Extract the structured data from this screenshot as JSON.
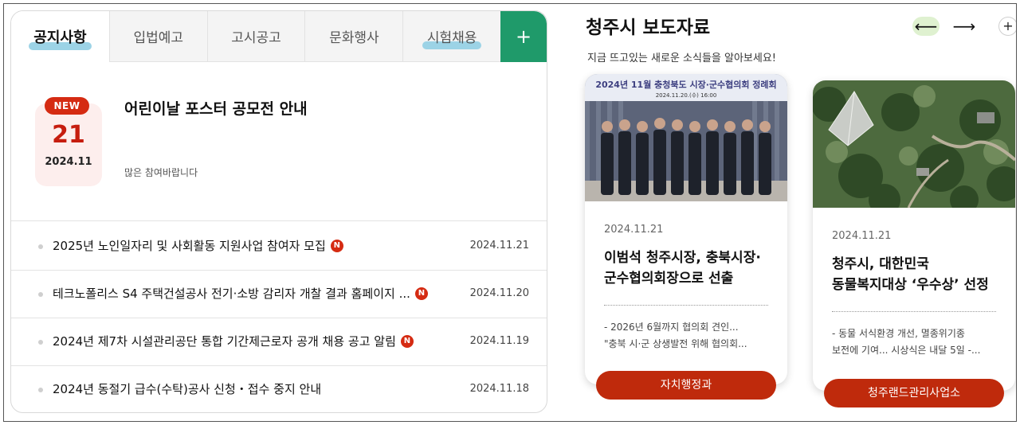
{
  "tabs": [
    {
      "label": "공지사항"
    },
    {
      "label": "입법예고"
    },
    {
      "label": "고시공고"
    },
    {
      "label": "문화행사"
    },
    {
      "label": "시험채용"
    },
    {
      "label": "+"
    }
  ],
  "featured": {
    "badge": "NEW",
    "day": "21",
    "year_month": "2024.11",
    "title": "어린이날 포스터 공모전 안내",
    "desc": "많은 참여바랍니다"
  },
  "notices": [
    {
      "title": "2025년 노인일자리 및 사회활동 지원사업 참여자 모집",
      "badge": "N",
      "date": "2024.11.21"
    },
    {
      "title": "테크노폴리스 S4 주택건설공사 전기·소방 감리자 개찰 결과 홈페이지 ...",
      "badge": "N",
      "date": "2024.11.20"
    },
    {
      "title": "2024년 제7차 시설관리공단 통합 기간제근로자 공개 채용 공고 알림",
      "badge": "N",
      "date": "2024.11.19"
    },
    {
      "title": "2024년 동절기 급수(수탁)공사 신청・접수 중지 안내",
      "date": "2024.11.18"
    }
  ],
  "press": {
    "title": "청주시 보도자료",
    "subtitle": "지금 뜨고있는 새로운 소식들을 알아보세요!",
    "prev_icon": "⟵",
    "next_icon": "⟶",
    "more_icon": "+",
    "cards": [
      {
        "banner": "2024년 11월 충청북도 시장·군수협의회 정례회",
        "banner_sub": "2024.11.20.(수) 16:00",
        "date": "2024.11.21",
        "title_1": "이범석 청주시장, 충북시장·",
        "title_2": "군수협의회장으로 선출",
        "desc_1": "- 2026년 6월까지 협의회 견인...",
        "desc_2": "\"충북 시·군 상생발전 위해 협의회...",
        "button": "자치행정과"
      },
      {
        "date": "2024.11.21",
        "title_1": "청주시, 대한민국",
        "title_2": "동물복지대상 ‘우수상’ 선정",
        "desc_1": "- 동물 서식환경 개선, 멸종위기종",
        "desc_2": "보전에 기여... 시상식은 내달 5일 -...",
        "button": "청주랜드관리사업소"
      }
    ]
  },
  "colors": {
    "accent_green": "#1f9a6a",
    "accent_red": "#d52b12",
    "button_red": "#bf2a0c",
    "tab_highlight": "#9cd3e6",
    "arrow_bg": "#dff1d0"
  }
}
